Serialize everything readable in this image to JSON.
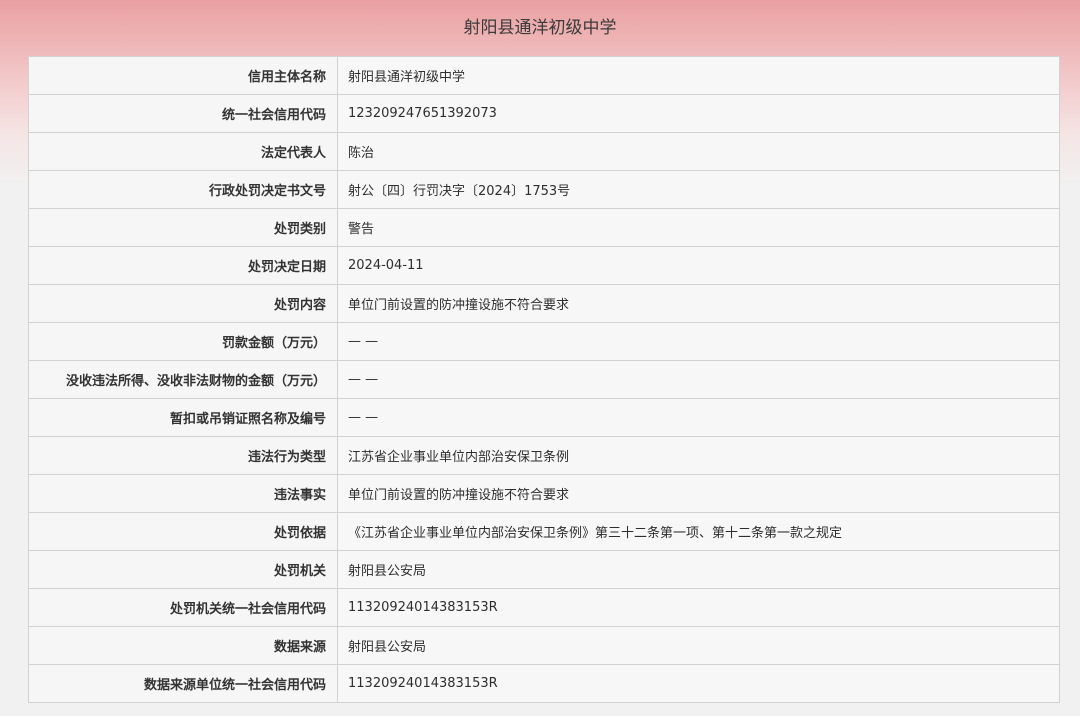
{
  "header": {
    "title": "射阳县通洋初级中学"
  },
  "record": {
    "rows": [
      {
        "label": "信用主体名称",
        "value": "射阳县通洋初级中学"
      },
      {
        "label": "统一社会信用代码",
        "value": "123209247651392073"
      },
      {
        "label": "法定代表人",
        "value": "陈治"
      },
      {
        "label": "行政处罚决定书文号",
        "value": "射公〔四〕行罚决字〔2024〕1753号"
      },
      {
        "label": "处罚类别",
        "value": "警告"
      },
      {
        "label": "处罚决定日期",
        "value": "2024-04-11"
      },
      {
        "label": "处罚内容",
        "value": "单位门前设置的防冲撞设施不符合要求"
      },
      {
        "label": "罚款金额（万元）",
        "value": "— —"
      },
      {
        "label": "没收违法所得、没收非法财物的金额（万元）",
        "value": "— —"
      },
      {
        "label": "暂扣或吊销证照名称及编号",
        "value": "— —"
      },
      {
        "label": "违法行为类型",
        "value": "江苏省企业事业单位内部治安保卫条例"
      },
      {
        "label": "违法事实",
        "value": "单位门前设置的防冲撞设施不符合要求"
      },
      {
        "label": "处罚依据",
        "value": "《江苏省企业事业单位内部治安保卫条例》第三十二条第一项、第十二条第一款之规定"
      },
      {
        "label": "处罚机关",
        "value": "射阳县公安局"
      },
      {
        "label": "处罚机关统一社会信用代码",
        "value": "11320924014383153R"
      },
      {
        "label": "数据来源",
        "value": "射阳县公安局"
      },
      {
        "label": "数据来源单位统一社会信用代码",
        "value": "11320924014383153R"
      }
    ]
  }
}
